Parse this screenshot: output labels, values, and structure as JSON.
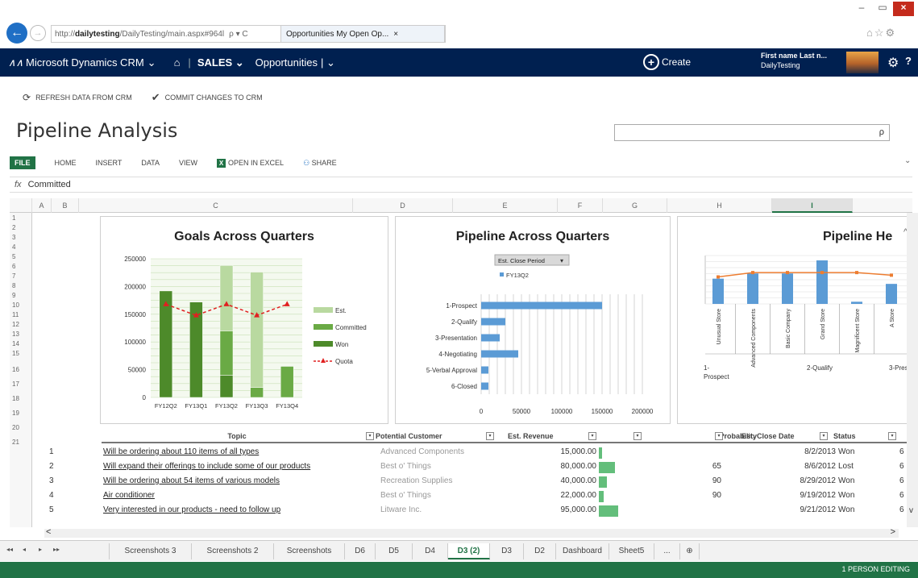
{
  "browser": {
    "url_prefix": "http://",
    "url_host": "dailytesting",
    "url_rest": "/DailyTesting/main.aspx#964l",
    "url_icons": "ρ ▾ C",
    "tab_title": "Opportunities My Open Op...",
    "tab_close": "×",
    "back": "←",
    "forward": "→",
    "win_min": "–",
    "win_max": "▭",
    "win_close": "×",
    "icons": "⌂☆⚙"
  },
  "crm": {
    "brand": "Microsoft Dynamics CRM",
    "brand_caret": "⌄",
    "home": "⌂",
    "sep": "|",
    "area": "SALES ⌄",
    "entity": "Opportunities",
    "entity_caret": "| ⌄",
    "create_label": "Create",
    "user_name": "First name Last n...",
    "user_org": "DailyTesting",
    "gear": "⚙",
    "help": "?"
  },
  "commands": {
    "refresh": "REFRESH DATA FROM CRM",
    "commit": "COMMIT CHANGES TO CRM"
  },
  "page_title": "Pipeline Analysis",
  "search_icon": "ρ",
  "ribbon": {
    "file": "FILE",
    "home": "HOME",
    "insert": "INSERT",
    "data": "DATA",
    "view": "VIEW",
    "excel_icon": "X",
    "open_excel": "OPEN IN EXCEL",
    "share": "SHARE",
    "chevron": "⌄"
  },
  "formula": {
    "fx": "fx",
    "value": "Committed"
  },
  "columns": [
    "A",
    "B",
    "C",
    "D",
    "E",
    "F",
    "G",
    "H",
    "I"
  ],
  "rows": [
    "1",
    "2",
    "3",
    "4",
    "5",
    "6",
    "7",
    "8",
    "9",
    "10",
    "11",
    "12",
    "13",
    "14",
    "15",
    "16",
    "17",
    "18",
    "19",
    "20",
    "21"
  ],
  "chart_goals": {
    "type": "bar",
    "title": "Goals Across Quarters",
    "categories": [
      "FY12Q2",
      "FY13Q1",
      "FY13Q2",
      "FY13Q3",
      "FY13Q4"
    ],
    "ylim": [
      0,
      250000
    ],
    "yticks": [
      "250000",
      "200000",
      "150000",
      "100000",
      "50000",
      "0"
    ],
    "series": [
      {
        "name": "Won",
        "values": [
          192000,
          172000,
          40000,
          0,
          0
        ],
        "color": "#4d8a2a"
      },
      {
        "name": "Committed",
        "values": [
          0,
          0,
          80000,
          18000,
          56000
        ],
        "color": "#6aaa45"
      },
      {
        "name": "Est.",
        "values": [
          0,
          0,
          118000,
          208000,
          0
        ],
        "color": "#b9d9a0"
      },
      {
        "name": "Quota",
        "values": [
          168000,
          148000,
          168000,
          148000,
          168000
        ],
        "color": "#e02020"
      }
    ],
    "legend": [
      "Est.",
      "Committed",
      "Won",
      "Quota"
    ]
  },
  "chart_pipeline": {
    "type": "bar",
    "title": "Pipeline Across Quarters",
    "filter_label": "Est. Close Period",
    "legend": [
      "FY13Q2"
    ],
    "categories": [
      "1-Prospect",
      "2-Qualify",
      "3-Presentation",
      "4-Negotiating",
      "5-Verbal Approval",
      "6-Closed"
    ],
    "values": [
      150000,
      30000,
      23000,
      46000,
      9000,
      9000
    ],
    "xlim": [
      0,
      200000
    ],
    "xticks": [
      "0",
      "50000",
      "100000",
      "150000",
      "200000"
    ],
    "color": "#5b9bd5"
  },
  "chart_health": {
    "type": "bar",
    "title": "Pipeline He",
    "categories": [
      "Unusual Store",
      "Advanced Components",
      "Basic Company",
      "Grand Store",
      "Magnificent Store",
      "A Store"
    ],
    "values": [
      0.58,
      0.7,
      0.7,
      1.0,
      0.05,
      0.46
    ],
    "line": [
      0.62,
      0.72,
      0.72,
      0.72,
      0.72,
      0.66
    ],
    "groups": [
      "1-\nProspect",
      "2-Qualify",
      "3-Pres"
    ],
    "scroll_up": "^",
    "bar_color": "#5b9bd5",
    "line_color": "#ed7d31"
  },
  "table": {
    "headers": [
      "Topic",
      "Potential Customer",
      "Est. Revenue",
      "Probability",
      "Est. Close Date",
      "Status"
    ],
    "rows": [
      {
        "n": "1",
        "topic": "Will be ordering about 110 items of all types",
        "customer": "Advanced Components",
        "revenue": "15,000.00",
        "prob": "",
        "date": "8/2/2013",
        "status": "Won",
        "extra": "6",
        "bar": 0.16
      },
      {
        "n": "2",
        "topic": "Will expand their offerings to include some of our products",
        "customer": "Best o' Things",
        "revenue": "80,000.00",
        "prob": "65",
        "date": "8/6/2012",
        "status": "Lost",
        "extra": "6",
        "bar": 0.84
      },
      {
        "n": "3",
        "topic": "Will be ordering about 54 items of various models",
        "customer": "Recreation Supplies",
        "revenue": "40,000.00",
        "prob": "90",
        "date": "8/29/2012",
        "status": "Won",
        "extra": "6",
        "bar": 0.42
      },
      {
        "n": "4",
        "topic": "Air conditioner",
        "customer": "Best o' Things",
        "revenue": "22,000.00",
        "prob": "90",
        "date": "9/19/2012",
        "status": "Won",
        "extra": "6",
        "bar": 0.23
      },
      {
        "n": "5",
        "topic": "Very interested in our products - need to follow up",
        "customer": "Litware Inc.",
        "revenue": "95,000.00",
        "prob": "",
        "date": "9/21/2012",
        "status": "Won",
        "extra": "6",
        "bar": 1.0
      }
    ]
  },
  "scroll": {
    "left": "<",
    "right": ">",
    "down": "v"
  },
  "sheet_nav": [
    "◂◂",
    "◂",
    "▸",
    "▸▸"
  ],
  "sheets": [
    "Screenshots 3",
    "Screenshots 2",
    "Screenshots",
    "D6",
    "D5",
    "D4",
    "D3 (2)",
    "D3",
    "D2",
    "Dashboard",
    "Sheet5",
    "...",
    "⊕"
  ],
  "active_sheet": "D3 (2)",
  "status_text": "1 PERSON EDITING"
}
